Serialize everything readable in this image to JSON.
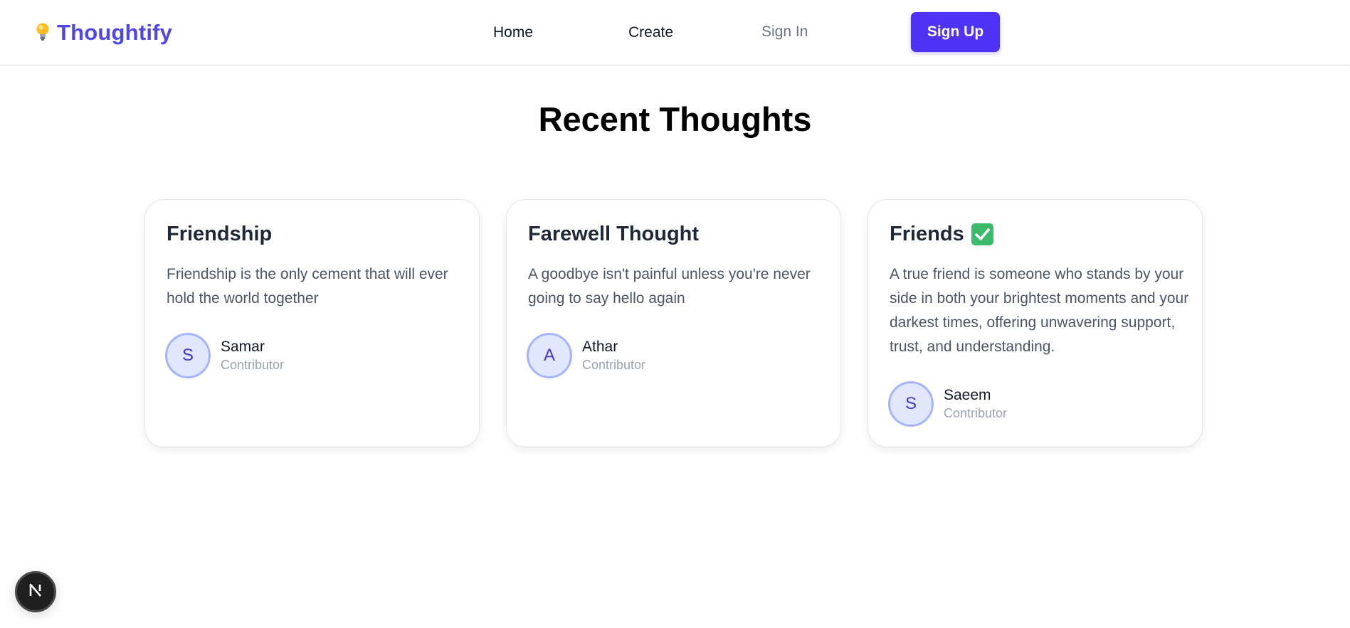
{
  "nav": {
    "brand": "Thoughtify",
    "home": "Home",
    "create": "Create",
    "sign_in": "Sign In",
    "sign_up": "Sign Up"
  },
  "page": {
    "title": "Recent Thoughts"
  },
  "cards": [
    {
      "title": "Friendship",
      "body": "Friendship is the only cement that will ever hold the world together",
      "avatar_initial": "S",
      "author": "Samar",
      "role": "Contributor"
    },
    {
      "title": "Farewell Thought",
      "body": "A goodbye isn't painful unless you're never going to say hello again",
      "avatar_initial": "A",
      "author": "Athar",
      "role": "Contributor"
    },
    {
      "title": "Friends",
      "body": "A true friend is someone who stands by your side in both your brightest moments and your darkest times, offering unwavering support, trust, and understanding.",
      "avatar_initial": "S",
      "author": "Saeem",
      "role": "Contributor"
    }
  ],
  "dev_badge": {
    "letter": "N"
  },
  "colors": {
    "brand": "#4f46e5",
    "primary_button": "#4f32f5",
    "avatar_bg": "#e0e7ff",
    "avatar_border": "#a5b4fc",
    "check_badge": "#3dbb6c"
  },
  "icons": {
    "brand": "lightbulb-icon",
    "title_badge": "check-mark-icon",
    "dev_badge": "nextjs-icon"
  }
}
